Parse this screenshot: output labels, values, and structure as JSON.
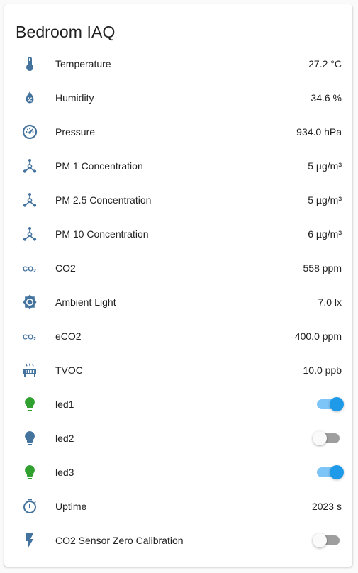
{
  "card": {
    "title": "Bedroom IAQ"
  },
  "colors": {
    "icon": "#44739e",
    "icon_on": "#30a02f",
    "switch_on": "#1e9ae8",
    "switch_on_track": "#7dc4f7",
    "switch_off_track": "#9e9e9e"
  },
  "rows": [
    {
      "label": "Temperature",
      "value": "27.2 °C",
      "icon": "thermometer-icon"
    },
    {
      "label": "Humidity",
      "value": "34.6 %",
      "icon": "water-percent-icon"
    },
    {
      "label": "Pressure",
      "value": "934.0 hPa",
      "icon": "gauge-icon"
    },
    {
      "label": "PM 1 Concentration",
      "value": "5 µg/m³",
      "icon": "molecule-icon"
    },
    {
      "label": "PM 2.5 Concentration",
      "value": "5 µg/m³",
      "icon": "molecule-icon"
    },
    {
      "label": "PM 10 Concentration",
      "value": "6 µg/m³",
      "icon": "molecule-icon"
    },
    {
      "label": "CO2",
      "value": "558 ppm",
      "icon": "molecule-co2-icon"
    },
    {
      "label": "Ambient Light",
      "value": "7.0 lx",
      "icon": "brightness-icon"
    },
    {
      "label": "eCO2",
      "value": "400.0 ppm",
      "icon": "molecule-co2-icon"
    },
    {
      "label": "TVOC",
      "value": "10.0 ppb",
      "icon": "radiator-icon"
    },
    {
      "label": "led1",
      "state": "on",
      "icon": "lightbulb-icon"
    },
    {
      "label": "led2",
      "state": "off",
      "icon": "lightbulb-icon"
    },
    {
      "label": "led3",
      "state": "on",
      "icon": "lightbulb-icon"
    },
    {
      "label": "Uptime",
      "value": "2023 s",
      "icon": "timer-icon"
    },
    {
      "label": "CO2 Sensor Zero Calibration",
      "state": "off",
      "icon": "flash-icon"
    }
  ]
}
